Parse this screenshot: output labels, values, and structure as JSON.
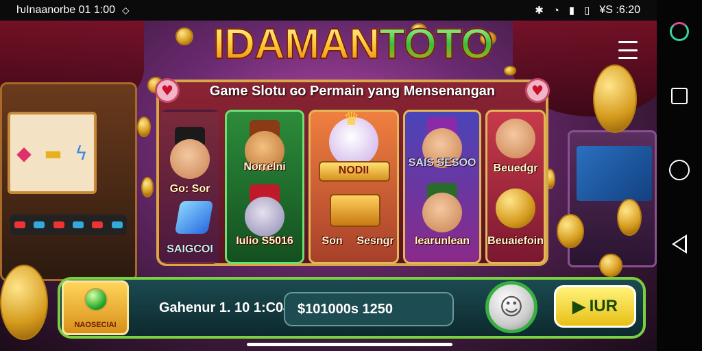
{
  "status_bar": {
    "left_text": "ƕInaanorbe 01 1:00",
    "location_icon": "location-pin-icon",
    "right_icons": [
      "puzzle-icon",
      "alarm-icon",
      "battery-low-icon",
      "battery-icon",
      "signal-icon"
    ],
    "right_text": "¥S :6:20"
  },
  "game": {
    "title_part1": "IDAMAN",
    "title_part2": "TOTO",
    "subtitle": "Game Slotu ɢo Permain yang Mensenangan",
    "columns": [
      {
        "top_label": "Go: Sor",
        "bottom_label": "SAIGCOI"
      },
      {
        "top_label": "Norrelni",
        "bottom_label": "Iulio S5016"
      },
      {
        "top_label": "NODII",
        "bottom_label_left": "Son",
        "bottom_label_right": "Sesngr"
      },
      {
        "top_label": "SAIS SESOO",
        "bottom_label": "Iearunlean"
      },
      {
        "top_label": "Beuedgr",
        "bottom_label": "Beuaiefoin"
      }
    ],
    "badge_text": "NAOSECIAI",
    "date_text": "Gahenur 1. 10 1:C04",
    "balance": "$101000s 1250",
    "play_label": "IUR",
    "play_icon": "play-icon",
    "round_button_icon": "character-icon",
    "menu_icon": "hamburger-menu-icon",
    "colors": {
      "accent_gold": "#d8a848",
      "accent_green": "#7ad040",
      "panel_red": "#8a2434"
    }
  },
  "navbar": {
    "buttons": [
      "app-icon",
      "recent-apps-icon",
      "home-icon",
      "back-icon"
    ]
  }
}
